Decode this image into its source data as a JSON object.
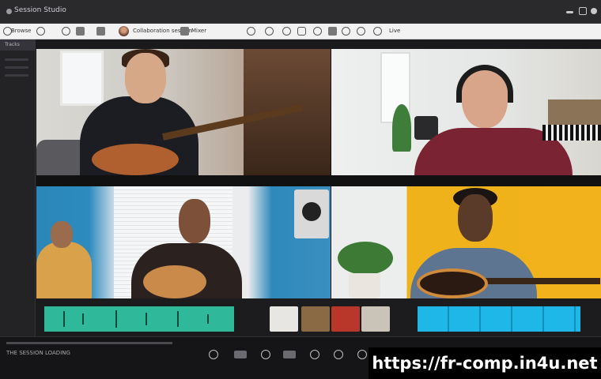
{
  "window": {
    "title": "Session Studio",
    "controls": [
      "minimize-icon",
      "maximize-icon",
      "close-icon"
    ]
  },
  "toolbar": {
    "left_label": "Browse",
    "menu_label": "Collaboration session",
    "mid_label": "Mixer",
    "right_label": "Live"
  },
  "sidebar": {
    "header": "Tracks"
  },
  "participants": [
    {
      "tile": "living-room-guitarist",
      "background": "#d9d8d4"
    },
    {
      "tile": "headphones-keyboardist",
      "background": "#eef0ef"
    },
    {
      "tile": "blue-room-duo",
      "background": "#2c86b8"
    },
    {
      "tile": "yellow-wall-guitarist",
      "background": "#f0b21a"
    }
  ],
  "tracks": {
    "green_color": "#2fb89a",
    "blue_color": "#1fb6e8"
  },
  "transport": {
    "status_text": "THE SESSION LOADING"
  },
  "watermark": {
    "text": "https://fr-comp.in4u.net"
  }
}
